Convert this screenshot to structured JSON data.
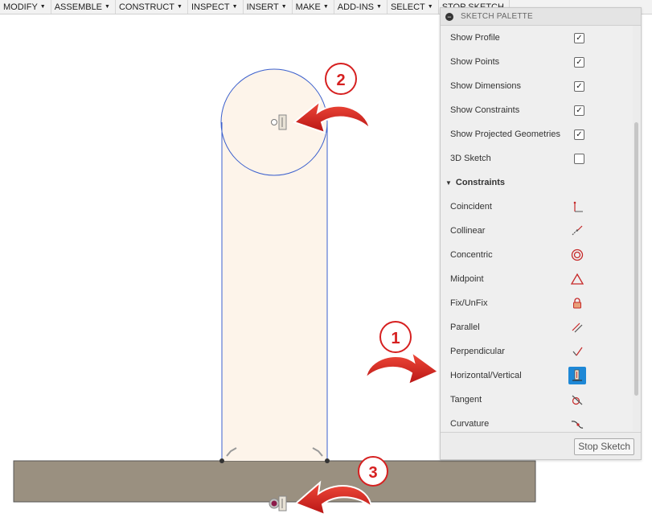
{
  "toolbar": {
    "items": [
      "MODIFY",
      "ASSEMBLE",
      "CONSTRUCT",
      "INSPECT",
      "INSERT",
      "MAKE",
      "ADD-INS",
      "SELECT",
      "STOP SKETCH"
    ]
  },
  "palette": {
    "title": "SKETCH PALETTE",
    "options": [
      {
        "label": "Show Profile",
        "checked": true,
        "mark": "✓"
      },
      {
        "label": "Show Points",
        "checked": true,
        "mark": "✓"
      },
      {
        "label": "Show Dimensions",
        "checked": true,
        "mark": "✓"
      },
      {
        "label": "Show Constraints",
        "checked": true,
        "mark": "✓"
      },
      {
        "label": "Show Projected Geometries",
        "checked": true,
        "mark": "✓"
      },
      {
        "label": "3D Sketch",
        "checked": false,
        "mark": ""
      }
    ],
    "constraints_heading": "Constraints",
    "constraints": [
      {
        "label": "Coincident",
        "icon": "coincident-icon"
      },
      {
        "label": "Collinear",
        "icon": "collinear-icon"
      },
      {
        "label": "Concentric",
        "icon": "concentric-icon"
      },
      {
        "label": "Midpoint",
        "icon": "midpoint-icon"
      },
      {
        "label": "Fix/UnFix",
        "icon": "lock-icon"
      },
      {
        "label": "Parallel",
        "icon": "parallel-icon"
      },
      {
        "label": "Perpendicular",
        "icon": "perpendicular-icon"
      },
      {
        "label": "Horizontal/Vertical",
        "icon": "horizontal-vertical-icon",
        "active": true
      },
      {
        "label": "Tangent",
        "icon": "tangent-icon"
      },
      {
        "label": "Curvature",
        "icon": "curvature-icon"
      }
    ],
    "stop_button": "Stop Sketch"
  },
  "callouts": [
    "1",
    "2",
    "3"
  ],
  "colors": {
    "sketch_line": "#3a5fcd",
    "profile_fill": "#fdf4ea",
    "body_fill": "#9a9080",
    "callout_red": "#d62020",
    "active_icon_bg": "#1e88d6"
  }
}
